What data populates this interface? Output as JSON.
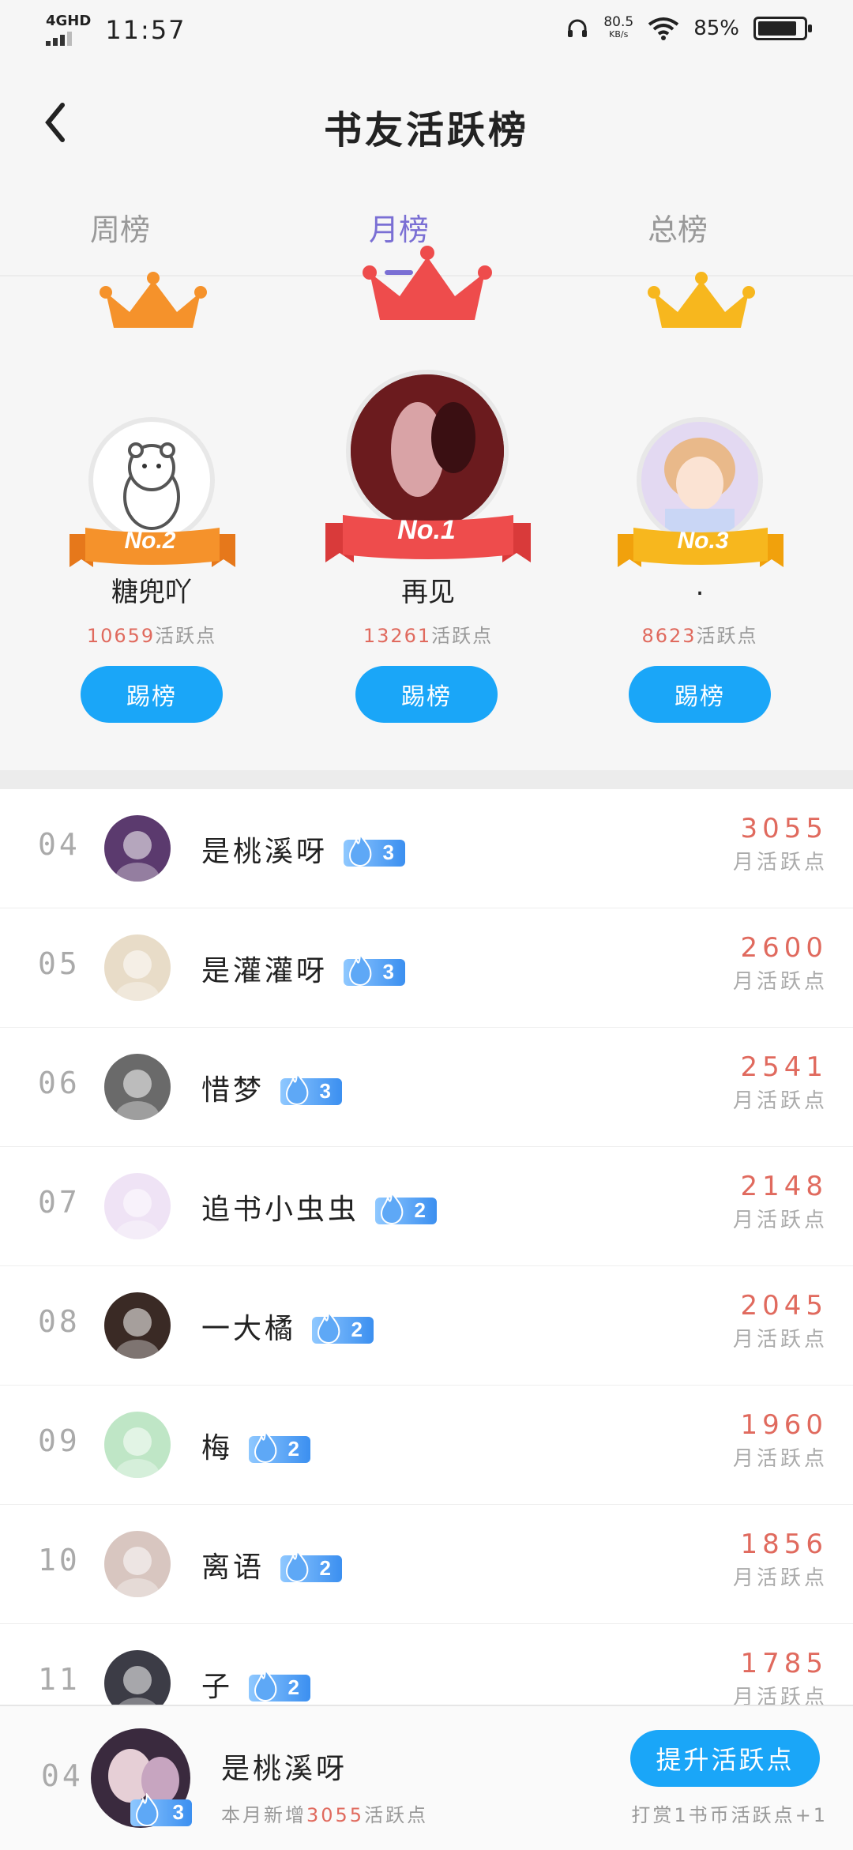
{
  "status_bar": {
    "network": "4GHD",
    "time": "11:57",
    "speed": "80.5",
    "speed_unit": "KB/s",
    "battery_pct": "85%",
    "battery_level": 0.85
  },
  "header": {
    "title": "书友活跃榜"
  },
  "tabs": [
    {
      "label": "周榜",
      "active": false
    },
    {
      "label": "月榜",
      "active": true
    },
    {
      "label": "总榜",
      "active": false
    }
  ],
  "podium": {
    "first": {
      "badge": "No.1",
      "name": "再见",
      "points": "13261",
      "points_suffix": "活跃点",
      "button": "踢榜"
    },
    "second": {
      "badge": "No.2",
      "name": "糖兜吖",
      "points": "10659",
      "points_suffix": "活跃点",
      "button": "踢榜"
    },
    "third": {
      "badge": "No.3",
      "name": ".",
      "points": "8623",
      "points_suffix": "活跃点",
      "button": "踢榜"
    }
  },
  "list": {
    "unit": "月活跃点",
    "rows": [
      {
        "rank": "04",
        "name": "是桃溪呀",
        "level": "3",
        "points": "3055"
      },
      {
        "rank": "05",
        "name": "是灌灌呀",
        "level": "3",
        "points": "2600"
      },
      {
        "rank": "06",
        "name": "惜梦",
        "level": "3",
        "points": "2541"
      },
      {
        "rank": "07",
        "name": "追书小虫虫",
        "level": "2",
        "points": "2148"
      },
      {
        "rank": "08",
        "name": "一大橘",
        "level": "2",
        "points": "2045"
      },
      {
        "rank": "09",
        "name": "梅",
        "level": "2",
        "points": "1960"
      },
      {
        "rank": "10",
        "name": "离语",
        "level": "2",
        "points": "1856"
      },
      {
        "rank": "11",
        "name": "子",
        "level": "2",
        "points": "1785"
      }
    ]
  },
  "bottom": {
    "rank": "04",
    "name": "是桃溪呀",
    "level": "3",
    "sub_prefix": "本月新增",
    "sub_points": "3055",
    "sub_suffix": "活跃点",
    "button": "提升活跃点",
    "tip": "打赏1书币活跃点+1"
  }
}
